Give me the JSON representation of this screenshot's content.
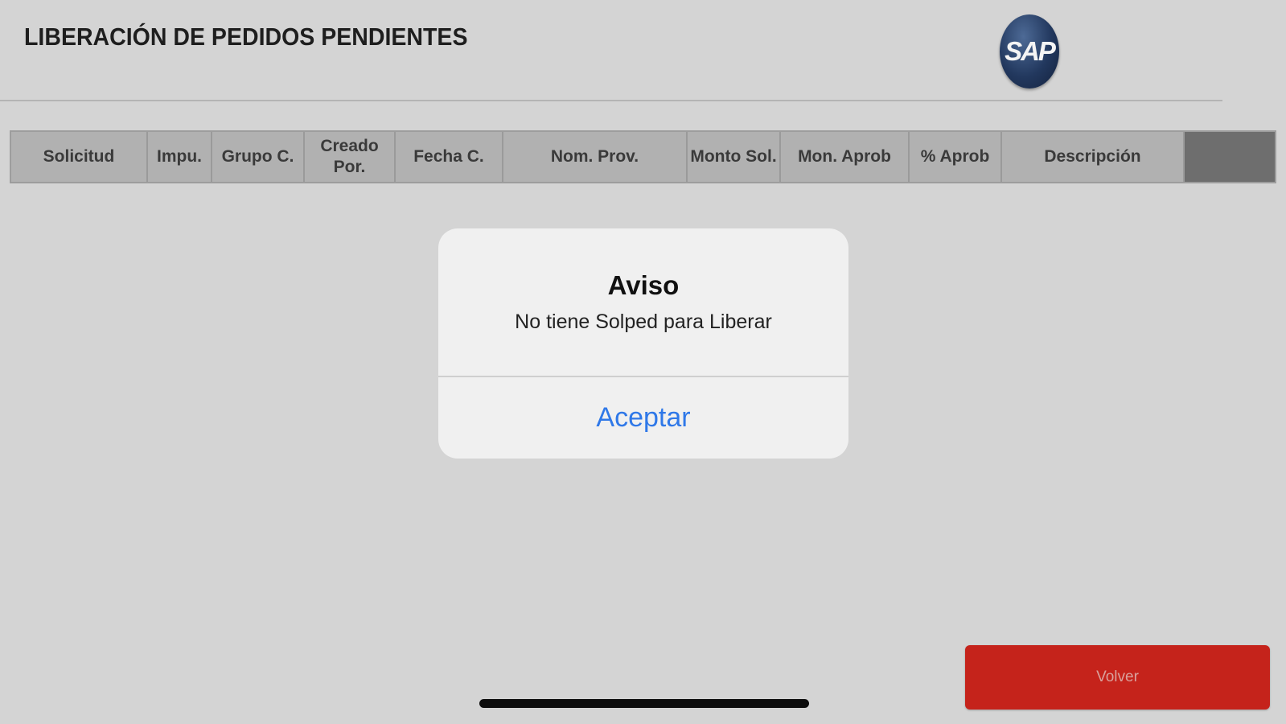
{
  "header": {
    "title": "LIBERACIÓN DE PEDIDOS PENDIENTES",
    "logo_text": "SAP"
  },
  "table": {
    "columns": [
      {
        "label": "Solicitud",
        "name": "col-solicitud"
      },
      {
        "label": "Impu.",
        "name": "col-impu"
      },
      {
        "label": "Grupo C.",
        "name": "col-grupo-c"
      },
      {
        "label": "Creado\nPor.",
        "name": "col-creado-por"
      },
      {
        "label": "Fecha C.",
        "name": "col-fecha-c"
      },
      {
        "label": "Nom. Prov.",
        "name": "col-nom-prov"
      },
      {
        "label": "Monto Sol.",
        "name": "col-monto-sol"
      },
      {
        "label": "Mon. Aprob",
        "name": "col-mon-aprob"
      },
      {
        "label": "% Aprob",
        "name": "col-pct-aprob"
      },
      {
        "label": "Descripción",
        "name": "col-descripcion"
      }
    ]
  },
  "dialog": {
    "title": "Aviso",
    "message": "No tiene Solped para Liberar",
    "button_label": "Aceptar",
    "button_color": "#2f78e8"
  },
  "footer": {
    "volver_label": "Volver",
    "volver_color": "#c5231b"
  }
}
